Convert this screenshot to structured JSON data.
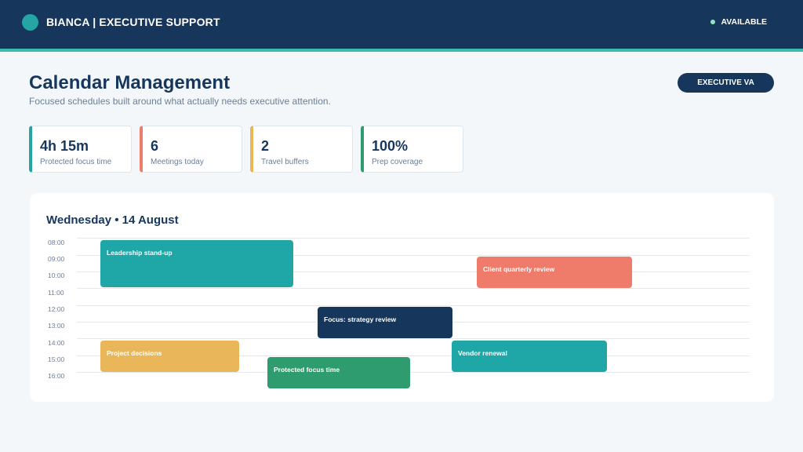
{
  "header": {
    "title": "BIANCA | EXECUTIVE SUPPORT",
    "status": "AVAILABLE"
  },
  "page": {
    "title": "Calendar Management",
    "subtitle": "Focused schedules built around what actually needs executive attention.",
    "role_badge": "EXECUTIVE VA"
  },
  "stats": [
    {
      "value": "4h 15m",
      "label": "Protected focus time",
      "color": "#26a5a5"
    },
    {
      "value": "6",
      "label": "Meetings today",
      "color": "#ef7b6b"
    },
    {
      "value": "2",
      "label": "Travel buffers",
      "color": "#e9b65a"
    },
    {
      "value": "100%",
      "label": "Prep coverage",
      "color": "#2f9c6f"
    }
  ],
  "calendar": {
    "title": "Wednesday • 14 August",
    "times": [
      "08:00",
      "09:00",
      "10:00",
      "11:00",
      "12:00",
      "13:00",
      "14:00",
      "15:00",
      "16:00"
    ],
    "events": [
      {
        "title": "Leadership stand-up",
        "color": "#1fa6a6"
      },
      {
        "title": "Client quarterly review",
        "color": "#ef7b6b"
      },
      {
        "title": "Focus: strategy review",
        "color": "#17365c"
      },
      {
        "title": "Project decisions",
        "color": "#e9b65a"
      },
      {
        "title": "Protected focus time",
        "color": "#2f9c6f"
      },
      {
        "title": "Vendor renewal",
        "color": "#1fa6a6"
      }
    ]
  }
}
